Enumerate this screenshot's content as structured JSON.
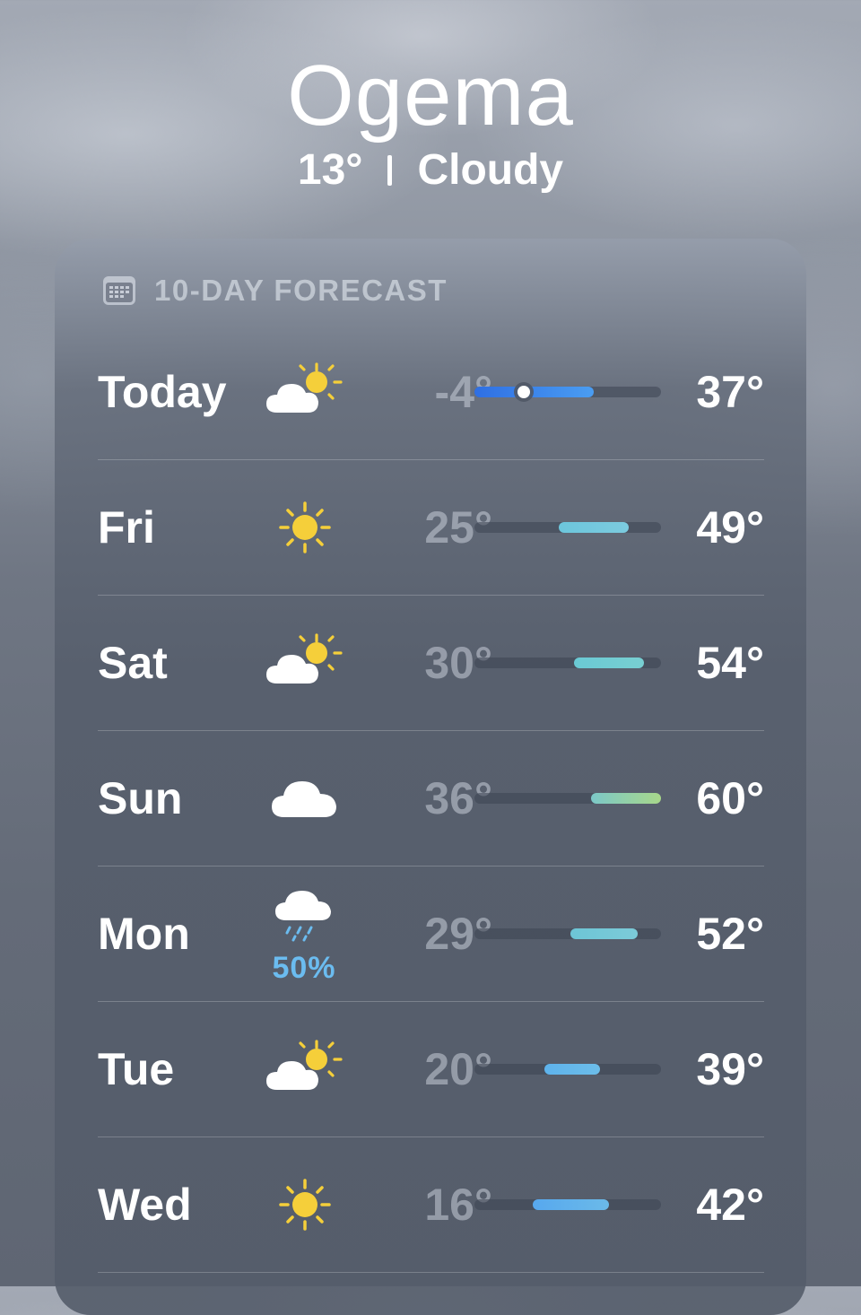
{
  "header": {
    "city": "Ogema",
    "temperature": "13°",
    "condition": "Cloudy"
  },
  "forecast": {
    "title": "10-DAY FORECAST",
    "title_icon": "calendar-icon",
    "range_min": -4,
    "range_max": 60,
    "days": [
      {
        "day": "Today",
        "icon": "partly-sunny-icon",
        "low": "-4°",
        "high": "37°",
        "low_value": -4,
        "high_value": 37,
        "current_value": 13,
        "bar_colors": [
          "#2f6fe3",
          "#4a9df2"
        ]
      },
      {
        "day": "Fri",
        "icon": "sun-icon",
        "low": "25°",
        "high": "49°",
        "low_value": 25,
        "high_value": 49,
        "bar_colors": [
          "#6cc6dc",
          "#7ccbdf"
        ]
      },
      {
        "day": "Sat",
        "icon": "partly-sunny-icon",
        "low": "30°",
        "high": "54°",
        "low_value": 30,
        "high_value": 54,
        "bar_colors": [
          "#6ac9d4",
          "#78cfd2"
        ]
      },
      {
        "day": "Sun",
        "icon": "cloud-icon",
        "low": "36°",
        "high": "60°",
        "low_value": 36,
        "high_value": 60,
        "bar_colors": [
          "#7cc8c8",
          "#a8d78a"
        ]
      },
      {
        "day": "Mon",
        "icon": "rain-cloud-icon",
        "precip": "50%",
        "low": "29°",
        "high": "52°",
        "low_value": 29,
        "high_value": 52,
        "bar_colors": [
          "#6dc5d6",
          "#7ccbd8"
        ]
      },
      {
        "day": "Tue",
        "icon": "partly-sunny-icon",
        "low": "20°",
        "high": "39°",
        "low_value": 20,
        "high_value": 39,
        "bar_colors": [
          "#5eb3ec",
          "#6cbde9"
        ]
      },
      {
        "day": "Wed",
        "icon": "sun-icon",
        "low": "16°",
        "high": "42°",
        "low_value": 16,
        "high_value": 42,
        "bar_colors": [
          "#57a8ee",
          "#6bbae9"
        ]
      }
    ]
  }
}
